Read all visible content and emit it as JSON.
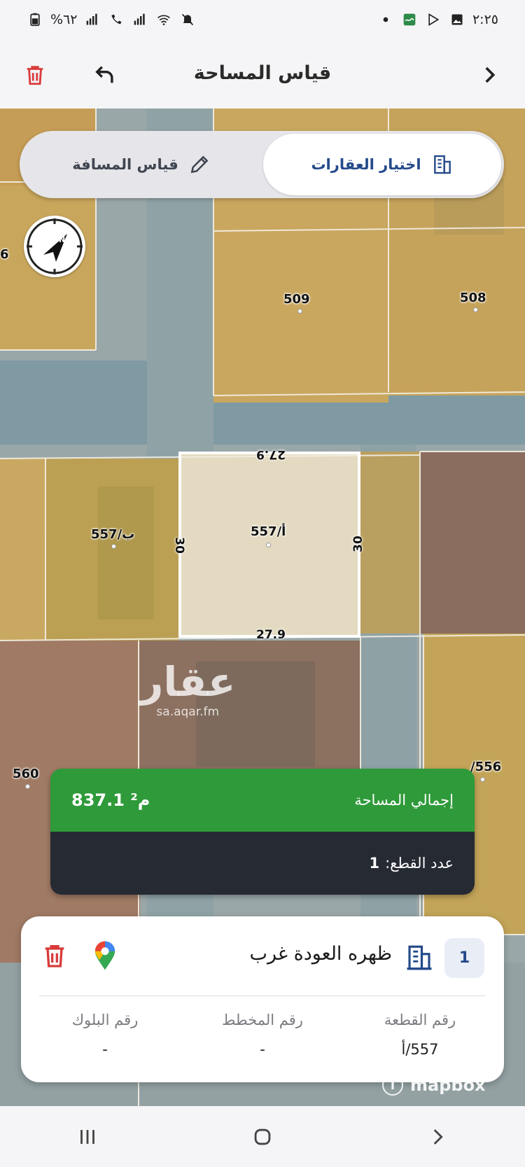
{
  "status_bar": {
    "time": "٢:٢٥",
    "battery": "%٦٢",
    "icons": [
      "notification-dot-icon",
      "aqar-app-icon",
      "play-store-icon",
      "gallery-icon",
      "mute-icon",
      "wifi-icon",
      "call-signal-1-icon",
      "call-signal-2-icon",
      "battery-icon"
    ]
  },
  "header": {
    "title": "قياس المساحة",
    "back_icon": "chevron-left-icon",
    "undo_icon": "undo-icon",
    "delete_icon": "trash-icon"
  },
  "mode_switch": {
    "active_label": "اختيار العقارات",
    "inactive_label": "قياس المسافة"
  },
  "map": {
    "plots": [
      {
        "label": "509"
      },
      {
        "label": "508"
      },
      {
        "label": "557/أ"
      },
      {
        "label": "557/ب"
      },
      {
        "label": "560"
      },
      {
        "label": "/556"
      },
      {
        "label": "6"
      }
    ],
    "dimensions": {
      "top": "27.9",
      "bottom": "27.9",
      "left": "30",
      "right": "30"
    },
    "watermark": {
      "logo": "عقار",
      "url": "sa.aqar.fm"
    },
    "attribution": "mapbox"
  },
  "area_card": {
    "label": "إجمالي المساحة",
    "value": "837.1 م²",
    "pieces_label": "عدد القطع:",
    "pieces_count": "1"
  },
  "parcel": {
    "index": "1",
    "name": "ظهره العودة غرب",
    "columns": [
      {
        "head": "رقم القطعة",
        "value": "557/أ"
      },
      {
        "head": "رقم المخطط",
        "value": "-"
      },
      {
        "head": "رقم البلوك",
        "value": "-"
      }
    ]
  },
  "colors": {
    "accent_blue": "#244a8a",
    "area_green": "#2f9a3a",
    "dark_panel": "#262a33",
    "delete_red": "#d93b3b"
  }
}
